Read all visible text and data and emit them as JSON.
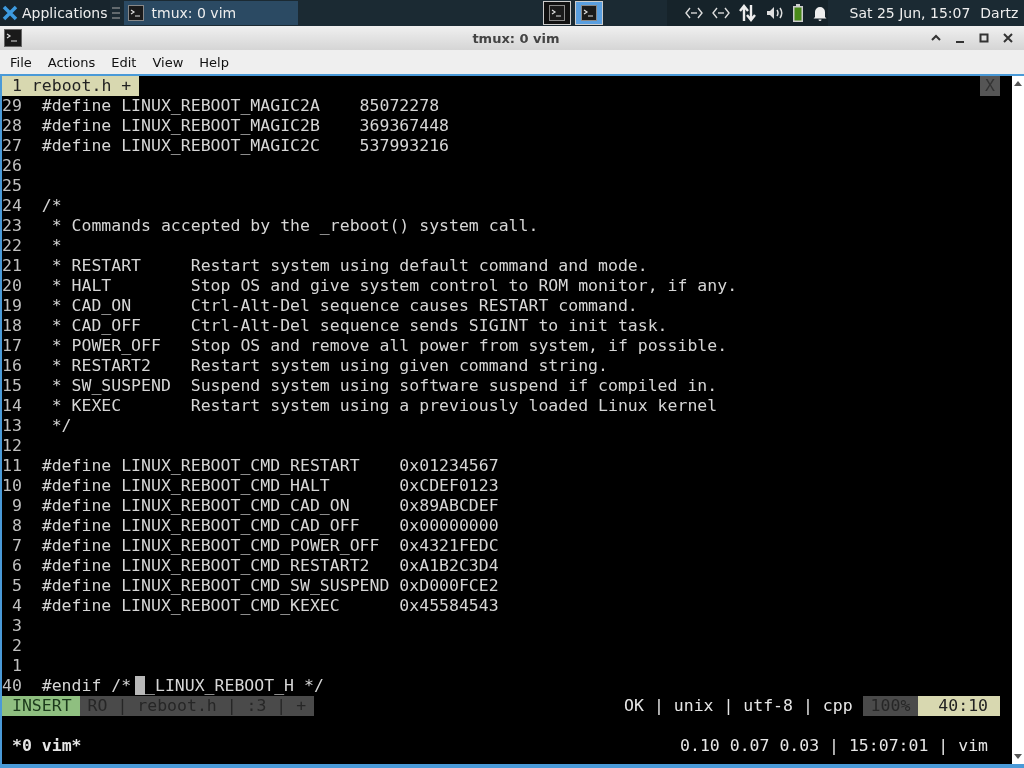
{
  "taskbar": {
    "app_menu": "Applications",
    "tasks": [
      {
        "title": "tmux: 0 vim",
        "selected": true
      }
    ],
    "workspaces": [
      {
        "selected": false
      },
      {
        "selected": true
      }
    ],
    "clock": "Sat 25 Jun, 15:07",
    "user": "Dartz"
  },
  "window": {
    "title": "tmux: 0 vim"
  },
  "menu": [
    "File",
    "Actions",
    "Edit",
    "View",
    "Help"
  ],
  "vim": {
    "tabs": [
      {
        "label": "1 reboot.h +",
        "selected": true
      }
    ],
    "close_label": "X",
    "lines": [
      {
        "number": "29",
        "text": "#define LINUX_REBOOT_MAGIC2A    85072278"
      },
      {
        "number": "28",
        "text": "#define LINUX_REBOOT_MAGIC2B    369367448"
      },
      {
        "number": "27",
        "text": "#define LINUX_REBOOT_MAGIC2C    537993216"
      },
      {
        "number": "26"
      },
      {
        "number": "25"
      },
      {
        "number": "24",
        "text": "/*"
      },
      {
        "number": "23",
        "text": " * Commands accepted by the _reboot() system call."
      },
      {
        "number": "22",
        "text": " *"
      },
      {
        "number": "21",
        "text": " * RESTART     Restart system using default command and mode."
      },
      {
        "number": "20",
        "text": " * HALT        Stop OS and give system control to ROM monitor, if any."
      },
      {
        "number": "19",
        "text": " * CAD_ON      Ctrl-Alt-Del sequence causes RESTART command."
      },
      {
        "number": "18",
        "text": " * CAD_OFF     Ctrl-Alt-Del sequence sends SIGINT to init task."
      },
      {
        "number": "17",
        "text": " * POWER_OFF   Stop OS and remove all power from system, if possible."
      },
      {
        "number": "16",
        "text": " * RESTART2    Restart system using given command string."
      },
      {
        "number": "15",
        "text": " * SW_SUSPEND  Suspend system using software suspend if compiled in."
      },
      {
        "number": "14",
        "text": " * KEXEC       Restart system using a previously loaded Linux kernel"
      },
      {
        "number": "13",
        "text": " */"
      },
      {
        "number": "12"
      },
      {
        "number": "11",
        "text": "#define LINUX_REBOOT_CMD_RESTART    0x01234567"
      },
      {
        "number": "10",
        "text": "#define LINUX_REBOOT_CMD_HALT       0xCDEF0123"
      },
      {
        "number": "9",
        "text": "#define LINUX_REBOOT_CMD_CAD_ON     0x89ABCDEF"
      },
      {
        "number": "8",
        "text": "#define LINUX_REBOOT_CMD_CAD_OFF    0x00000000"
      },
      {
        "number": "7",
        "text": "#define LINUX_REBOOT_CMD_POWER_OFF  0x4321FEDC"
      },
      {
        "number": "6",
        "text": "#define LINUX_REBOOT_CMD_RESTART2   0xA1B2C3D4"
      },
      {
        "number": "5",
        "text": "#define LINUX_REBOOT_CMD_SW_SUSPEND 0xD000FCE2"
      },
      {
        "number": "4",
        "text": "#define LINUX_REBOOT_CMD_KEXEC      0x45584543"
      },
      {
        "number": "3"
      },
      {
        "number": "2"
      },
      {
        "number": "1"
      },
      {
        "number": "40",
        "current": true,
        "text": "#endif /*",
        "after_cursor": "_LINUX_REBOOT_H */"
      }
    ],
    "statusline": {
      "mode": "INSERT",
      "info": "RO | reboot.h | :3 | +",
      "file_info": "OK | unix | utf-8 | cpp",
      "percent": "100%",
      "position": "40:10"
    }
  },
  "tmux": {
    "window": "*0 vim*",
    "status": "0.10 0.07 0.03 | 15:07:01 | vim"
  }
}
